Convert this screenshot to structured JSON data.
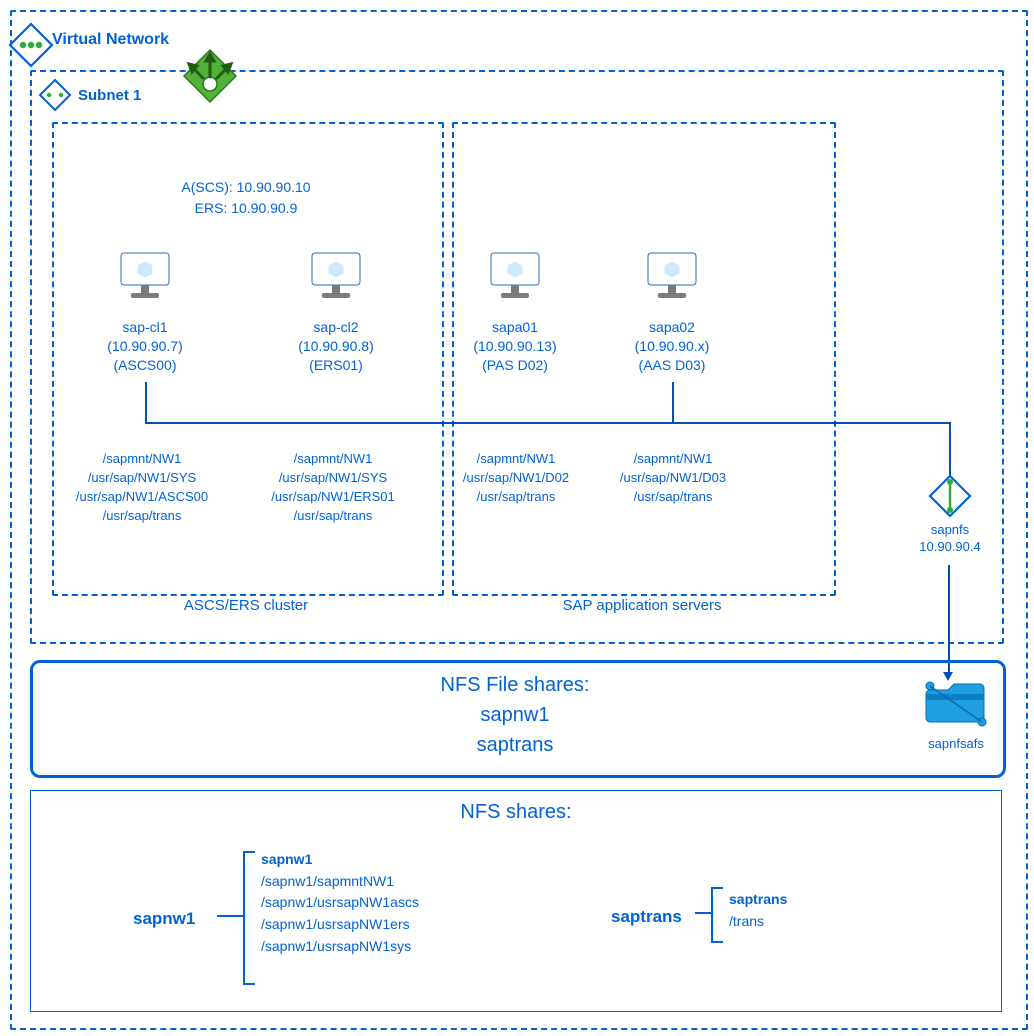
{
  "vnet": {
    "title": "Virtual Network"
  },
  "subnet": {
    "title": "Subnet 1"
  },
  "loadbalancer": {
    "line1": "A(SCS): 10.90.90.10",
    "line2": "ERS: 10.90.90.9"
  },
  "clusters": {
    "left_caption": "ASCS/ERS cluster",
    "right_caption": "SAP application servers"
  },
  "vms": {
    "vm1": {
      "name": "sap-cl1",
      "ip": "(10.90.90.7)",
      "role": "(ASCS00)",
      "p1": "/sapmnt/NW1",
      "p2": "/usr/sap/NW1/SYS",
      "p3": "/usr/sap/NW1/ASCS00",
      "p4": "/usr/sap/trans"
    },
    "vm2": {
      "name": "sap-cl2",
      "ip": "(10.90.90.8)",
      "role": "(ERS01)",
      "p1": "/sapmnt/NW1",
      "p2": "/usr/sap/NW1/SYS",
      "p3": "/usr/sap/NW1/ERS01",
      "p4": "/usr/sap/trans"
    },
    "vm3": {
      "name": "sapa01",
      "ip": "(10.90.90.13)",
      "role": "(PAS D02)",
      "p1": "/sapmnt/NW1",
      "p2": "/usr/sap/NW1/D02",
      "p3": "/usr/sap/trans"
    },
    "vm4": {
      "name": "sapa02",
      "ip": "(10.90.90.x)",
      "role": "(AAS D03)",
      "p1": "/sapmnt/NW1",
      "p2": "/usr/sap/NW1/D03",
      "p3": "/usr/sap/trans"
    }
  },
  "sapnfs": {
    "name": "sapnfs",
    "ip": "10.90.90.4"
  },
  "nfsbox": {
    "title": "NFS File shares:",
    "share1": "sapnw1",
    "share2": "saptrans"
  },
  "folder": {
    "label": "sapnfsafs"
  },
  "nfsshares": {
    "title": "NFS shares:",
    "s1": {
      "name": "sapnw1",
      "head": "sapnw1",
      "i1": "/sapnw1/sapmntNW1",
      "i2": "/sapnw1/usrsapNW1ascs",
      "i3": "/sapnw1/usrsapNW1ers",
      "i4": "/sapnw1/usrsapNW1sys"
    },
    "s2": {
      "name": "saptrans",
      "head": "saptrans",
      "i1": "/trans"
    }
  }
}
